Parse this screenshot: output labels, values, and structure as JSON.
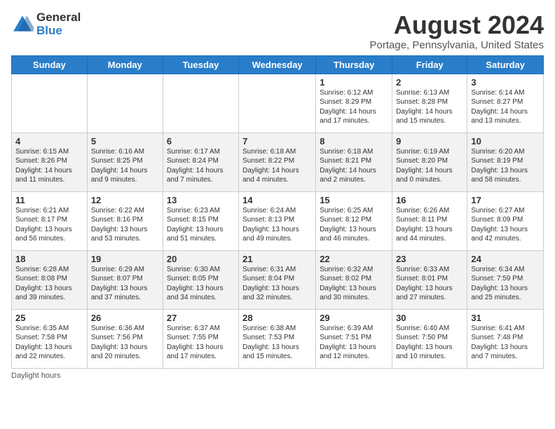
{
  "header": {
    "logo_line1": "General",
    "logo_line2": "Blue",
    "month_year": "August 2024",
    "location": "Portage, Pennsylvania, United States"
  },
  "days_of_week": [
    "Sunday",
    "Monday",
    "Tuesday",
    "Wednesday",
    "Thursday",
    "Friday",
    "Saturday"
  ],
  "footer": "Daylight hours",
  "weeks": [
    [
      {
        "day": "",
        "info": ""
      },
      {
        "day": "",
        "info": ""
      },
      {
        "day": "",
        "info": ""
      },
      {
        "day": "",
        "info": ""
      },
      {
        "day": "1",
        "info": "Sunrise: 6:12 AM\nSunset: 8:29 PM\nDaylight: 14 hours\nand 17 minutes."
      },
      {
        "day": "2",
        "info": "Sunrise: 6:13 AM\nSunset: 8:28 PM\nDaylight: 14 hours\nand 15 minutes."
      },
      {
        "day": "3",
        "info": "Sunrise: 6:14 AM\nSunset: 8:27 PM\nDaylight: 14 hours\nand 13 minutes."
      }
    ],
    [
      {
        "day": "4",
        "info": "Sunrise: 6:15 AM\nSunset: 8:26 PM\nDaylight: 14 hours\nand 11 minutes."
      },
      {
        "day": "5",
        "info": "Sunrise: 6:16 AM\nSunset: 8:25 PM\nDaylight: 14 hours\nand 9 minutes."
      },
      {
        "day": "6",
        "info": "Sunrise: 6:17 AM\nSunset: 8:24 PM\nDaylight: 14 hours\nand 7 minutes."
      },
      {
        "day": "7",
        "info": "Sunrise: 6:18 AM\nSunset: 8:22 PM\nDaylight: 14 hours\nand 4 minutes."
      },
      {
        "day": "8",
        "info": "Sunrise: 6:18 AM\nSunset: 8:21 PM\nDaylight: 14 hours\nand 2 minutes."
      },
      {
        "day": "9",
        "info": "Sunrise: 6:19 AM\nSunset: 8:20 PM\nDaylight: 14 hours\nand 0 minutes."
      },
      {
        "day": "10",
        "info": "Sunrise: 6:20 AM\nSunset: 8:19 PM\nDaylight: 13 hours\nand 58 minutes."
      }
    ],
    [
      {
        "day": "11",
        "info": "Sunrise: 6:21 AM\nSunset: 8:17 PM\nDaylight: 13 hours\nand 56 minutes."
      },
      {
        "day": "12",
        "info": "Sunrise: 6:22 AM\nSunset: 8:16 PM\nDaylight: 13 hours\nand 53 minutes."
      },
      {
        "day": "13",
        "info": "Sunrise: 6:23 AM\nSunset: 8:15 PM\nDaylight: 13 hours\nand 51 minutes."
      },
      {
        "day": "14",
        "info": "Sunrise: 6:24 AM\nSunset: 8:13 PM\nDaylight: 13 hours\nand 49 minutes."
      },
      {
        "day": "15",
        "info": "Sunrise: 6:25 AM\nSunset: 8:12 PM\nDaylight: 13 hours\nand 46 minutes."
      },
      {
        "day": "16",
        "info": "Sunrise: 6:26 AM\nSunset: 8:11 PM\nDaylight: 13 hours\nand 44 minutes."
      },
      {
        "day": "17",
        "info": "Sunrise: 6:27 AM\nSunset: 8:09 PM\nDaylight: 13 hours\nand 42 minutes."
      }
    ],
    [
      {
        "day": "18",
        "info": "Sunrise: 6:28 AM\nSunset: 8:08 PM\nDaylight: 13 hours\nand 39 minutes."
      },
      {
        "day": "19",
        "info": "Sunrise: 6:29 AM\nSunset: 8:07 PM\nDaylight: 13 hours\nand 37 minutes."
      },
      {
        "day": "20",
        "info": "Sunrise: 6:30 AM\nSunset: 8:05 PM\nDaylight: 13 hours\nand 34 minutes."
      },
      {
        "day": "21",
        "info": "Sunrise: 6:31 AM\nSunset: 8:04 PM\nDaylight: 13 hours\nand 32 minutes."
      },
      {
        "day": "22",
        "info": "Sunrise: 6:32 AM\nSunset: 8:02 PM\nDaylight: 13 hours\nand 30 minutes."
      },
      {
        "day": "23",
        "info": "Sunrise: 6:33 AM\nSunset: 8:01 PM\nDaylight: 13 hours\nand 27 minutes."
      },
      {
        "day": "24",
        "info": "Sunrise: 6:34 AM\nSunset: 7:59 PM\nDaylight: 13 hours\nand 25 minutes."
      }
    ],
    [
      {
        "day": "25",
        "info": "Sunrise: 6:35 AM\nSunset: 7:58 PM\nDaylight: 13 hours\nand 22 minutes."
      },
      {
        "day": "26",
        "info": "Sunrise: 6:36 AM\nSunset: 7:56 PM\nDaylight: 13 hours\nand 20 minutes."
      },
      {
        "day": "27",
        "info": "Sunrise: 6:37 AM\nSunset: 7:55 PM\nDaylight: 13 hours\nand 17 minutes."
      },
      {
        "day": "28",
        "info": "Sunrise: 6:38 AM\nSunset: 7:53 PM\nDaylight: 13 hours\nand 15 minutes."
      },
      {
        "day": "29",
        "info": "Sunrise: 6:39 AM\nSunset: 7:51 PM\nDaylight: 13 hours\nand 12 minutes."
      },
      {
        "day": "30",
        "info": "Sunrise: 6:40 AM\nSunset: 7:50 PM\nDaylight: 13 hours\nand 10 minutes."
      },
      {
        "day": "31",
        "info": "Sunrise: 6:41 AM\nSunset: 7:48 PM\nDaylight: 13 hours\nand 7 minutes."
      }
    ]
  ]
}
